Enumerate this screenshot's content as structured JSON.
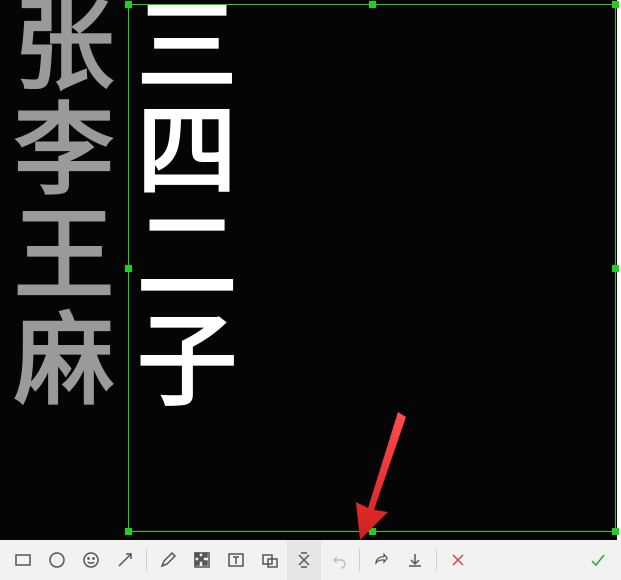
{
  "canvas": {
    "background_text": [
      "张",
      "李",
      "王",
      "麻"
    ],
    "selected_text": [
      "三",
      "四",
      "二",
      "子"
    ],
    "selection_color": "#1fd11f",
    "bg_text_color": "#9a9a9a",
    "fg_text_color": "#ffffff"
  },
  "annotation": {
    "arrow_color": "#e03232"
  },
  "toolbar": {
    "rect": "rectangle",
    "circle": "ellipse",
    "emoji": "sticker",
    "line": "arrow-line",
    "pen": "pen",
    "mosaic": "mosaic",
    "text": "text",
    "seq": "sequence-number",
    "pin": "pin",
    "undo": "undo",
    "share": "share",
    "save": "save",
    "cancel": "cancel",
    "confirm": "confirm"
  }
}
